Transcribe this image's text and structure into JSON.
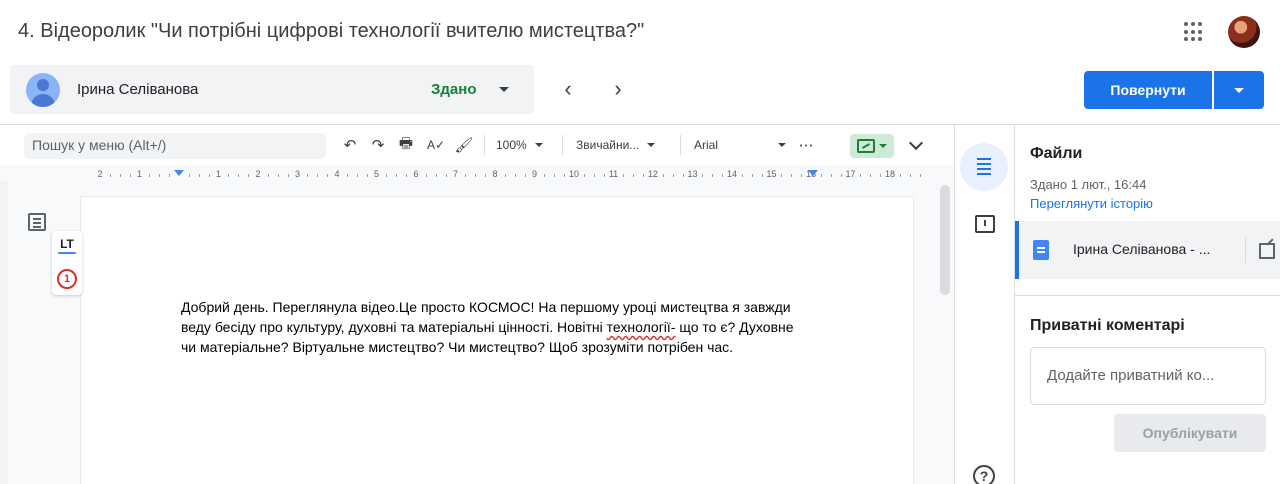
{
  "header": {
    "title": "4. Відеоролик \"Чи потрібні цифрові технології вчителю мистецтва?\"",
    "apps_icon": "apps-grid-icon",
    "avatar_icon": "profile-photo"
  },
  "student_bar": {
    "name": "Ірина Селіванова",
    "status": "Здано",
    "status_color": "#188038",
    "prev_icon": "chevron-left-icon",
    "next_icon": "chevron-right-icon",
    "prev_glyph": "‹",
    "next_glyph": "›"
  },
  "actions": {
    "return_label": "Повернути",
    "accent": "#1a73e8"
  },
  "toolbar": {
    "search_placeholder": "Пошук у меню (Alt+/)",
    "undo": "↶",
    "redo": "↷",
    "print": "🖶",
    "spellcheck": "A✓",
    "paint": "🖌",
    "zoom": "100%",
    "style": "Звичайни...",
    "font": "Arial",
    "more": "⋯"
  },
  "ruler": {
    "labels": [
      "2",
      "1",
      "",
      "1",
      "2",
      "3",
      "4",
      "5",
      "6",
      "7",
      "8",
      "9",
      "10",
      "11",
      "12",
      "13",
      "14",
      "15",
      "16",
      "17",
      "18"
    ]
  },
  "document": {
    "text_before": "Добрий день. Переглянула відео.Це просто КОСМОС! На першому уроці мистецтва я завжди веду бесіду про культуру, духовні та матеріальні цінності. Новітні ",
    "error_word": "технології-",
    "text_after": " що то є? Духовне чи матеріальне? Віртуальне мистецтво? Чи мистецтво? Щоб зрозуміти потрібен час."
  },
  "languagetool": {
    "logo": "LT",
    "issue_count": "1"
  },
  "side_panel": {
    "files_title": "Файли",
    "turned_in": "Здано 1 лют., 16:44",
    "history_link": "Переглянути історію",
    "file_name": "Ірина Селіванова - ...",
    "private_title": "Приватні коментарі",
    "private_placeholder": "Додайте приватний ко...",
    "publish_label": "Опублікувати",
    "help_glyph": "?"
  }
}
